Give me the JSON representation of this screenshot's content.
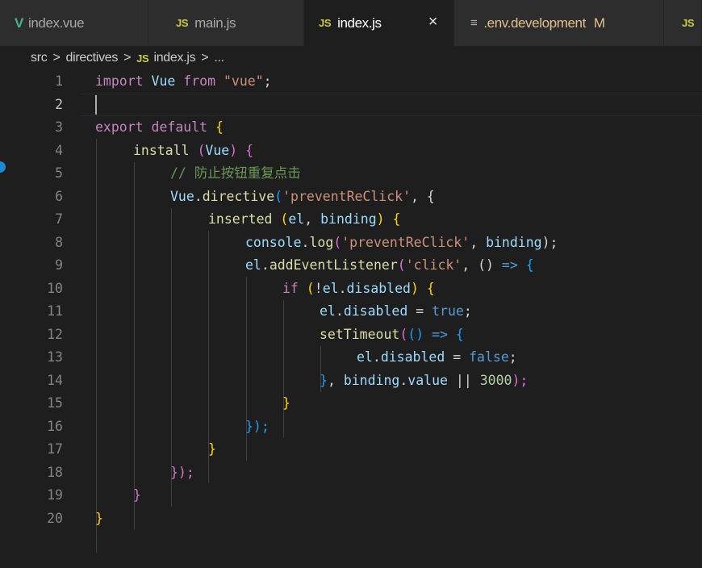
{
  "tabs": [
    {
      "icon": "vue-icon",
      "label": "index.vue"
    },
    {
      "icon": "js-icon",
      "label": "main.js"
    },
    {
      "icon": "js-icon",
      "label": "index.js",
      "active": true,
      "close": "×"
    },
    {
      "icon": "settings-file-icon",
      "label": ".env.development",
      "badge": "M"
    },
    {
      "icon": "js-icon",
      "label": ""
    }
  ],
  "js_glyph": "JS",
  "vue_glyph": "V",
  "env_glyph": "≡",
  "breadcrumb": [
    "src",
    "directives",
    "index.js",
    "..."
  ],
  "breadcrumb_sep": ">",
  "line_numbers": [
    "1",
    "2",
    "3",
    "4",
    "5",
    "6",
    "7",
    "8",
    "9",
    "10",
    "11",
    "12",
    "13",
    "14",
    "15",
    "16",
    "17",
    "18",
    "19",
    "20"
  ],
  "current_line": 2,
  "code": {
    "l1": [
      "import",
      " Vue",
      " from",
      " \"vue\"",
      ";"
    ],
    "l3": [
      "export",
      " default",
      " {"
    ],
    "l4": [
      "install",
      " (",
      "Vue",
      ")",
      " {"
    ],
    "l5": "// 防止按钮重复点击",
    "l6": [
      "Vue",
      ".",
      "directive",
      "(",
      "'preventReClick'",
      ", {"
    ],
    "l7": [
      "inserted",
      " (",
      "el",
      ", ",
      "binding",
      ") {"
    ],
    "l8": [
      "console",
      ".",
      "log",
      "(",
      "'preventReClick'",
      ", ",
      "binding",
      ");"
    ],
    "l9": [
      "el",
      ".",
      "addEventListener",
      "(",
      "'click'",
      ", () ",
      "=>",
      " {"
    ],
    "l10": [
      "if",
      " (",
      "!",
      "el",
      ".",
      "disabled",
      ")",
      " {"
    ],
    "l11": [
      "el",
      ".",
      "disabled",
      " = ",
      "true",
      ";"
    ],
    "l12": [
      "setTimeout",
      "(",
      "()",
      " => ",
      "{"
    ],
    "l13": [
      "el",
      ".",
      "disabled",
      " = ",
      "false",
      ";"
    ],
    "l14": [
      "}",
      ", ",
      "binding",
      ".",
      "value",
      " || ",
      "3000",
      ");"
    ],
    "l15": "}",
    "l16": "});",
    "l17": "}",
    "l18": "});",
    "l19": "}",
    "l20": "}"
  }
}
